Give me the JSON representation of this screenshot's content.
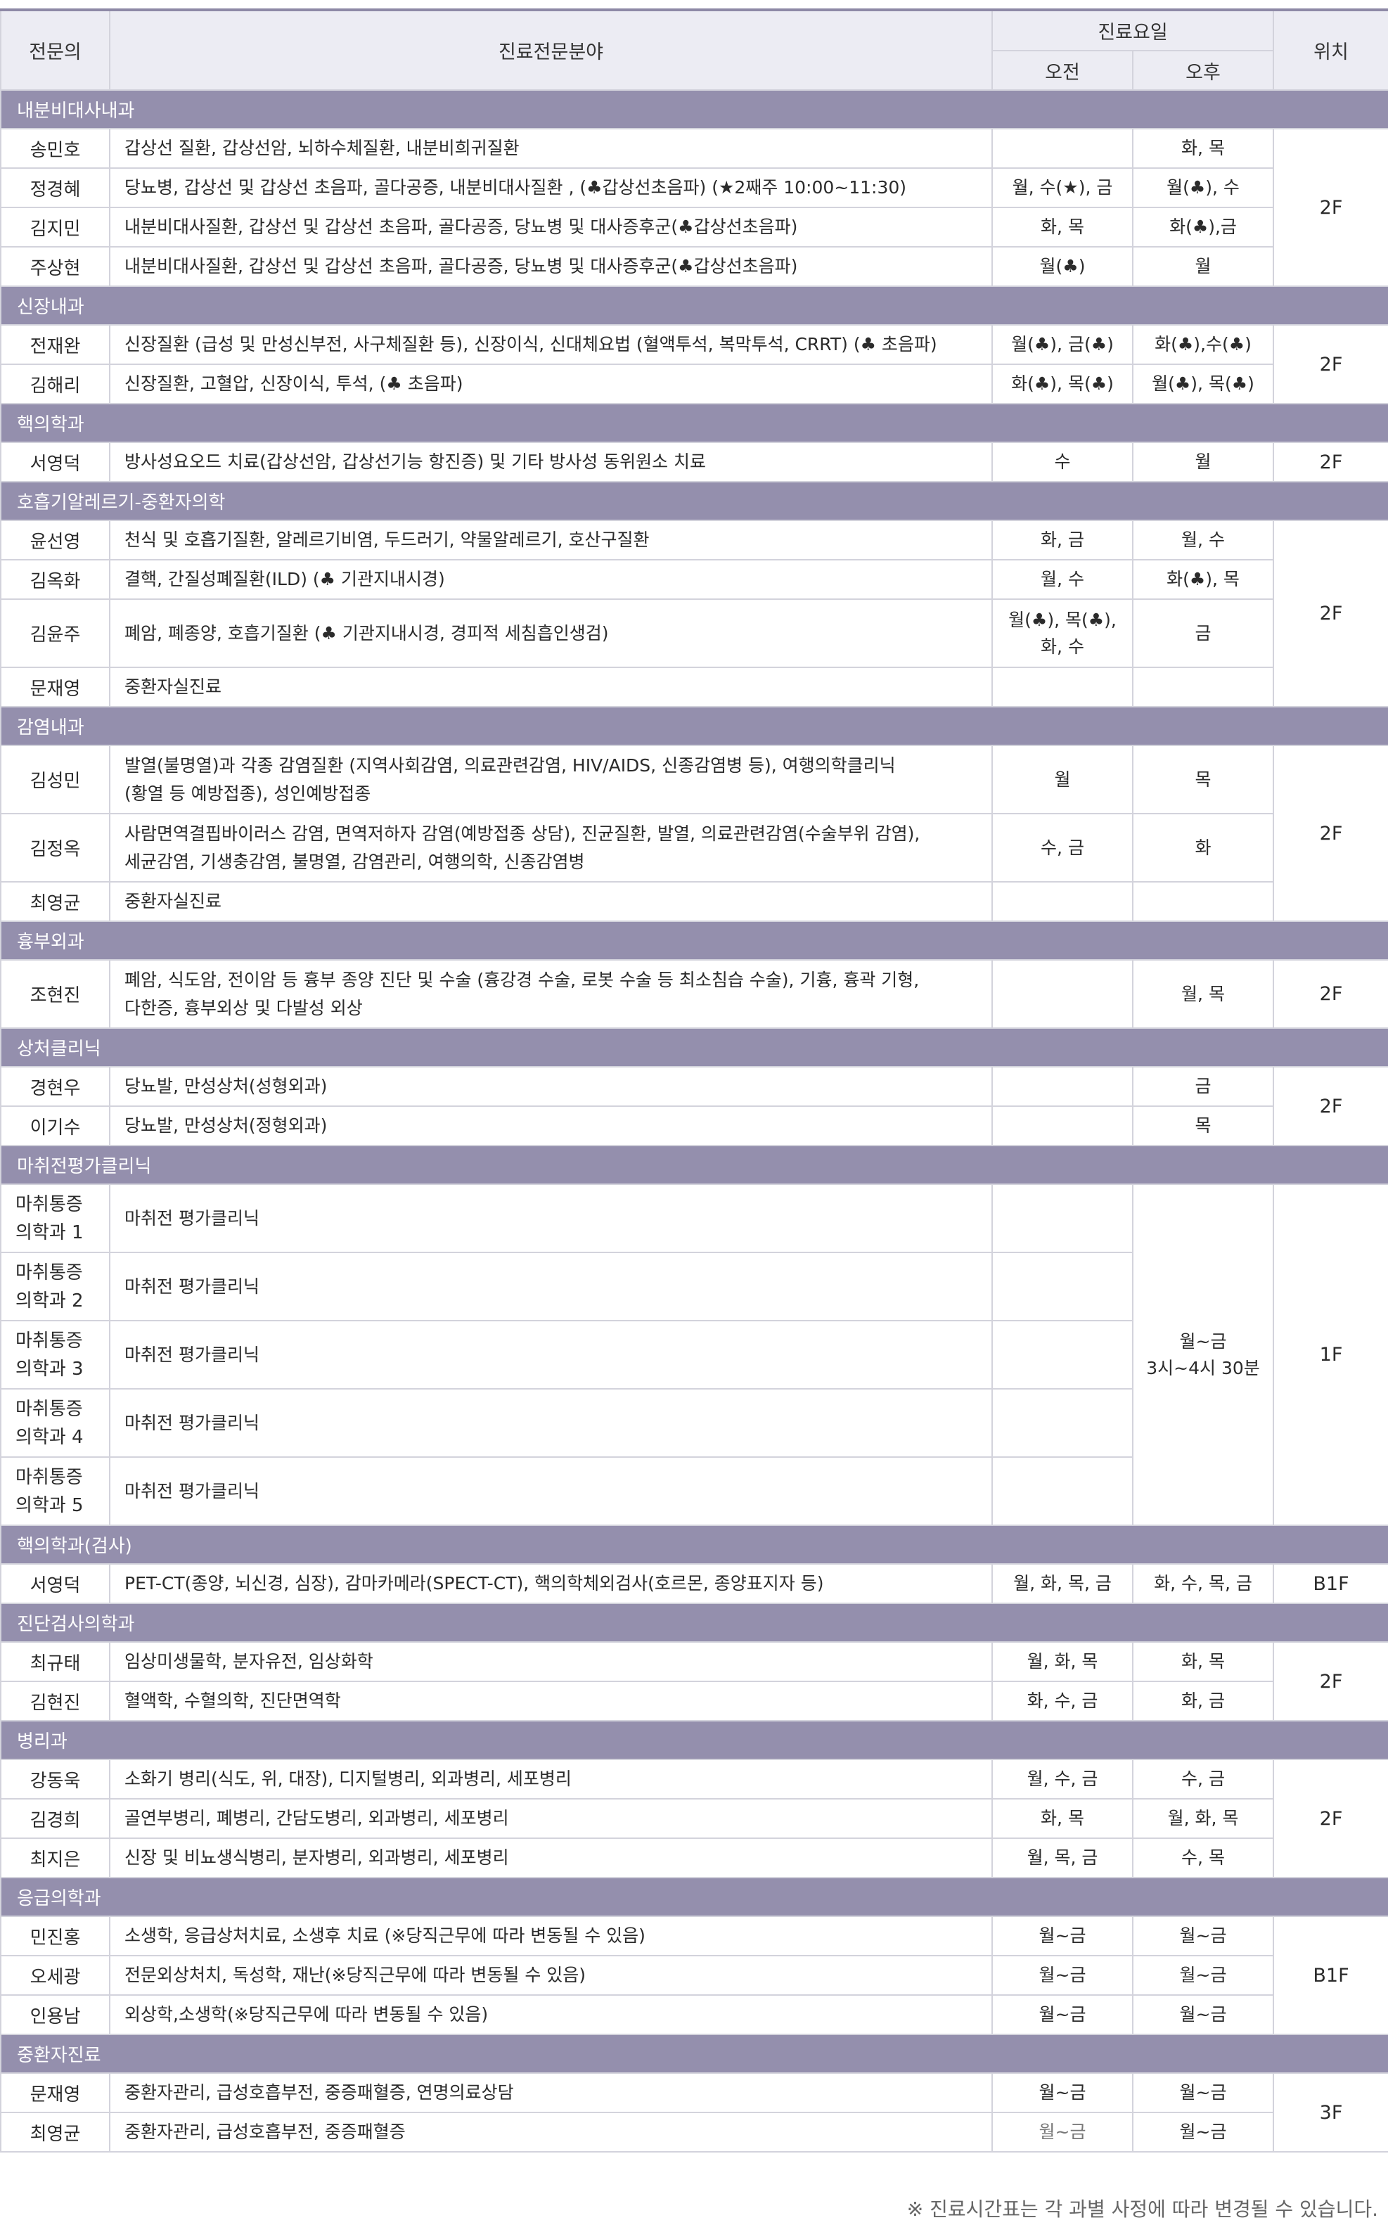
{
  "header": {
    "doctor": "전문의",
    "specialty": "진료전문분야",
    "days": "진료요일",
    "am": "오전",
    "pm": "오후",
    "location": "위치"
  },
  "sections": [
    {
      "title": "내분비대사내과",
      "doctors": [
        {
          "name": "송민호",
          "specialty": "갑상선 질환, 갑상선암, 뇌하수체질환, 내분비희귀질환",
          "am": "",
          "pm": "화, 목"
        },
        {
          "name": "정경혜",
          "specialty": "당뇨병, 갑상선 및 갑상선 초음파, 골다공증, 내분비대사질환 , (♣갑상선초음파) (★2째주 10:00~11:30)",
          "am": "월, 수(★), 금",
          "pm": "월(♣), 수"
        },
        {
          "name": "김지민",
          "specialty": "내분비대사질환, 갑상선 및 갑상선 초음파, 골다공증, 당뇨병 및 대사증후군(♣갑상선초음파)",
          "am": "화, 목",
          "pm": "화(♣),금"
        },
        {
          "name": "주상현",
          "specialty": "내분비대사질환, 갑상선 및 갑상선 초음파, 골다공증, 당뇨병 및 대사증후군(♣갑상선초음파)",
          "am": "월(♣)",
          "pm": "월"
        }
      ],
      "location": "2F"
    },
    {
      "title": "신장내과",
      "doctors": [
        {
          "name": "전재완",
          "specialty": "신장질환 (급성 및 만성신부전, 사구체질환 등), 신장이식, 신대체요법 (혈액투석, 복막투석, CRRT) (♣ 초음파)",
          "am": "월(♣), 금(♣)",
          "pm": "화(♣),수(♣)"
        },
        {
          "name": "김해리",
          "specialty": "신장질환, 고혈압, 신장이식, 투석, (♣ 초음파)",
          "am": "화(♣), 목(♣)",
          "pm": "월(♣), 목(♣)"
        }
      ],
      "location": "2F"
    },
    {
      "title": "핵의학과",
      "doctors": [
        {
          "name": "서영덕",
          "specialty": "방사성요오드 치료(갑상선암, 갑상선기능 항진증) 및 기타 방사성 동위원소 치료",
          "am": "수",
          "pm": "월"
        }
      ],
      "location": "2F"
    },
    {
      "title": "호흡기알레르기-중환자의학",
      "doctors": [
        {
          "name": "윤선영",
          "specialty": "천식 및 호흡기질환, 알레르기비염, 두드러기, 약물알레르기, 호산구질환",
          "am": "화, 금",
          "pm": "월, 수"
        },
        {
          "name": "김옥화",
          "specialty": "결핵, 간질성폐질환(ILD) (♣ 기관지내시경)",
          "am": "월, 수",
          "pm": "화(♣), 목"
        },
        {
          "name": "김윤주",
          "specialty": "폐암, 폐종양, 호흡기질환 (♣ 기관지내시경, 경피적 세침흡인생검)",
          "am": "월(♣), 목(♣),\n화, 수",
          "pm": "금"
        },
        {
          "name": "문재영",
          "specialty": "중환자실진료",
          "am": "",
          "pm": ""
        }
      ],
      "location": "2F"
    },
    {
      "title": "감염내과",
      "doctors": [
        {
          "name": "김성민",
          "specialty": "발열(불명열)과 각종 감염질환 (지역사회감염, 의료관련감염, HIV/AIDS, 신종감염병 등), 여행의학클리닉\n(황열 등 예방접종), 성인예방접종",
          "am": "월",
          "pm": "목"
        },
        {
          "name": "김정옥",
          "specialty": "사람면역결핍바이러스 감염, 면역저하자 감염(예방접종 상담), 진균질환, 발열, 의료관련감염(수술부위 감염),\n세균감염, 기생충감염, 불명열, 감염관리, 여행의학, 신종감염병",
          "am": "수, 금",
          "pm": "화"
        },
        {
          "name": "최영균",
          "specialty": "중환자실진료",
          "am": "",
          "pm": ""
        }
      ],
      "location": "2F"
    },
    {
      "title": "흉부외과",
      "doctors": [
        {
          "name": "조현진",
          "specialty": "폐암, 식도암, 전이암 등 흉부 종양 진단 및 수술 (흉강경 수술, 로봇 수술 등 최소침습 수술), 기흉, 흉곽 기형,\n다한증, 흉부외상 및 다발성 외상",
          "am": "",
          "pm": "월, 목"
        }
      ],
      "location": "2F"
    },
    {
      "title": "상처클리닉",
      "doctors": [
        {
          "name": "경현우",
          "specialty": "당뇨발, 만성상처(성형외과)",
          "am": "",
          "pm": "금"
        },
        {
          "name": "이기수",
          "specialty": "당뇨발, 만성상처(정형외과)",
          "am": "",
          "pm": "목"
        }
      ],
      "location": "2F"
    },
    {
      "title": "마취전평가클리닉",
      "doctors": [
        {
          "name": "마취통증\n의학과 1",
          "specialty": "마취전 평가클리닉",
          "am": ""
        },
        {
          "name": "마취통증\n의학과 2",
          "specialty": "마취전 평가클리닉",
          "am": ""
        },
        {
          "name": "마취통증\n의학과 3",
          "specialty": "마취전 평가클리닉",
          "am": ""
        },
        {
          "name": "마취통증\n의학과 4",
          "specialty": "마취전 평가클리닉",
          "am": ""
        },
        {
          "name": "마취통증\n의학과 5",
          "specialty": "마취전 평가클리닉",
          "am": ""
        }
      ],
      "pm_all": "월~금\n3시~4시 30분",
      "location": "1F"
    },
    {
      "title": "핵의학과(검사)",
      "doctors": [
        {
          "name": "서영덕",
          "specialty": "PET-CT(종양, 뇌신경, 심장), 감마카메라(SPECT-CT), 핵의학체외검사(호르몬, 종양표지자 등)",
          "am": "월, 화, 목, 금",
          "pm": "화, 수, 목, 금"
        }
      ],
      "location": "B1F"
    },
    {
      "title": "진단검사의학과",
      "doctors": [
        {
          "name": "최규태",
          "specialty": "임상미생물학, 분자유전, 임상화학",
          "am": "월, 화, 목",
          "pm": "화, 목"
        },
        {
          "name": "김현진",
          "specialty": "혈액학, 수혈의학, 진단면역학",
          "am": "화, 수, 금",
          "pm": "화, 금"
        }
      ],
      "location": "2F"
    },
    {
      "title": "병리과",
      "doctors": [
        {
          "name": "강동욱",
          "specialty": "소화기 병리(식도, 위, 대장), 디지털병리, 외과병리, 세포병리",
          "am": "월, 수, 금",
          "pm": "수, 금"
        },
        {
          "name": "김경희",
          "specialty": "골연부병리, 폐병리, 간담도병리, 외과병리, 세포병리",
          "am": "화, 목",
          "pm": "월, 화, 목"
        },
        {
          "name": "최지은",
          "specialty": "신장 및 비뇨생식병리, 분자병리, 외과병리, 세포병리",
          "am": "월, 목, 금",
          "pm": "수, 목"
        }
      ],
      "location": "2F"
    },
    {
      "title": "응급의학과",
      "doctors": [
        {
          "name": "민진홍",
          "specialty": "소생학, 응급상처치료, 소생후 치료 (※당직근무에 따라 변동될 수 있음)",
          "am": "월~금",
          "pm": "월~금"
        },
        {
          "name": "오세광",
          "specialty": "전문외상처치, 독성학, 재난(※당직근무에 따라 변동될 수 있음)",
          "am": "월~금",
          "pm": "월~금"
        },
        {
          "name": "인용남",
          "specialty": "외상학,소생학(※당직근무에 따라 변동될 수 있음)",
          "am": "월~금",
          "pm": "월~금"
        }
      ],
      "location": "B1F"
    },
    {
      "title": "중환자진료",
      "doctors": [
        {
          "name": "문재영",
          "specialty": "중환자관리, 급성호흡부전, 중증패혈증, 연명의료상담",
          "am": "월~금",
          "pm": "월~금"
        },
        {
          "name": "최영균",
          "specialty": "중환자관리, 급성호흡부전, 중증패혈증",
          "am": "월~금",
          "pm": "월~금"
        }
      ],
      "location": "3F"
    }
  ],
  "footnote": "※ 진료시간표는 각 과별 사정에 따라 변경될 수 있습니다."
}
